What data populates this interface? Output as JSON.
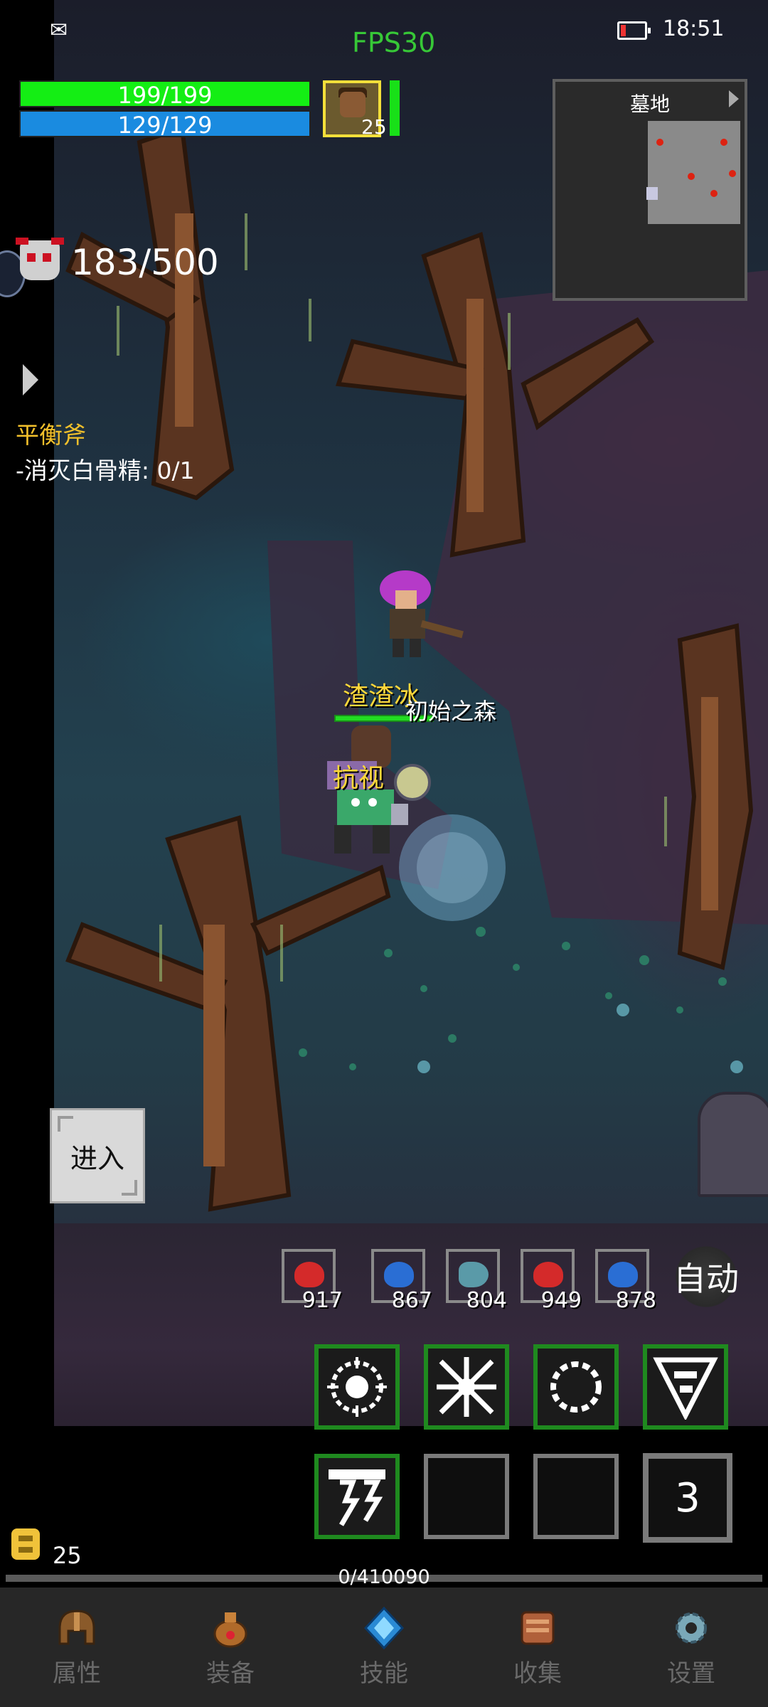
{
  "status_bar": {
    "notification_icon": "chat-bubbles-icon",
    "fps": "FPS30",
    "battery_icon": "battery-low-icon",
    "time": "18:51"
  },
  "player": {
    "hp": "199/199",
    "mp": "129/129",
    "level": "25",
    "hp_color": "#14ee14",
    "mp_color": "#1a8be0"
  },
  "minimap": {
    "title": "墓地"
  },
  "kills": {
    "icon": "demon-skull-icon",
    "count": "183/500"
  },
  "quest": {
    "title": "平衡斧",
    "objective": "-消灭白骨精: 0/1"
  },
  "scene": {
    "player_name": "渣渣冰",
    "ally_name": "抗视",
    "area_name": "初始之森"
  },
  "enter_button": {
    "label": "进入"
  },
  "potions": [
    {
      "icon": "red-potion-icon",
      "count": "917",
      "color": "#d42a2a"
    },
    {
      "icon": "blue-potion-icon",
      "count": "867",
      "color": "#2a6ed4"
    },
    {
      "icon": "fish-icon",
      "count": "804",
      "color": "#5a9aa8"
    },
    {
      "icon": "red-potion-icon",
      "count": "949",
      "color": "#d42a2a"
    },
    {
      "icon": "blue-potion-icon",
      "count": "878",
      "color": "#2a6ed4"
    }
  ],
  "auto_button": {
    "label": "自动"
  },
  "skills": {
    "page": "3"
  },
  "gold": {
    "icon": "gold-coin-icon",
    "count": "25"
  },
  "experience": {
    "text": "0/410090"
  },
  "bottom_nav": [
    {
      "label": "属性",
      "icon": "helmet-icon"
    },
    {
      "label": "装备",
      "icon": "bag-icon"
    },
    {
      "label": "技能",
      "icon": "crystal-icon"
    },
    {
      "label": "收集",
      "icon": "book-icon"
    },
    {
      "label": "设置",
      "icon": "gear-icon"
    }
  ]
}
